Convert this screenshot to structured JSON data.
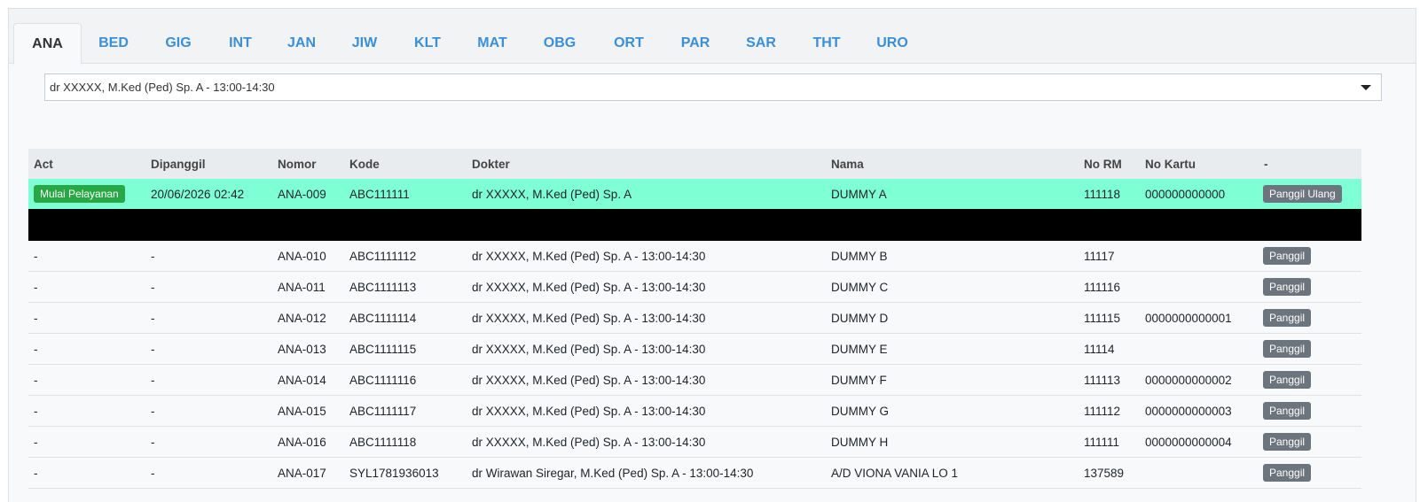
{
  "tabs": [
    {
      "label": "ANA",
      "active": true
    },
    {
      "label": "BED"
    },
    {
      "label": "GIG"
    },
    {
      "label": "INT"
    },
    {
      "label": "JAN"
    },
    {
      "label": "JIW"
    },
    {
      "label": "KLT"
    },
    {
      "label": "MAT"
    },
    {
      "label": "OBG"
    },
    {
      "label": "ORT"
    },
    {
      "label": "PAR"
    },
    {
      "label": "SAR"
    },
    {
      "label": "THT"
    },
    {
      "label": "URO"
    }
  ],
  "doctor_select": {
    "value": "dr XXXXX, M.Ked (Ped) Sp. A - 13:00-14:30"
  },
  "table": {
    "headers": [
      "Act",
      "Dipanggil",
      "Nomor",
      "Kode",
      "Dokter",
      "Nama",
      "No RM",
      "No Kartu",
      "-"
    ],
    "active_row": {
      "act_button": "Mulai Pelayanan",
      "dipanggil": "20/06/2026 02:42",
      "nomor": "ANA-009",
      "kode": "ABC111111",
      "dokter": "dr XXXXX, M.Ked (Ped) Sp. A",
      "nama": "DUMMY A",
      "no_rm": "111118",
      "no_kartu": "000000000000",
      "call_button": "Panggil Ulang"
    },
    "rows": [
      {
        "act": "-",
        "dipanggil": "-",
        "nomor": "ANA-010",
        "kode": "ABC1111112",
        "dokter": "dr XXXXX, M.Ked (Ped) Sp. A - 13:00-14:30",
        "nama": "DUMMY B",
        "no_rm": "11117",
        "no_kartu": "",
        "button": "Panggil"
      },
      {
        "act": "-",
        "dipanggil": "-",
        "nomor": "ANA-011",
        "kode": "ABC1111113",
        "dokter": "dr XXXXX, M.Ked (Ped) Sp. A - 13:00-14:30",
        "nama": "DUMMY C",
        "no_rm": "111116",
        "no_kartu": "",
        "button": "Panggil"
      },
      {
        "act": "-",
        "dipanggil": "-",
        "nomor": "ANA-012",
        "kode": "ABC1111114",
        "dokter": "dr XXXXX, M.Ked (Ped) Sp. A - 13:00-14:30",
        "nama": "DUMMY D",
        "no_rm": "111115",
        "no_kartu": "0000000000001",
        "button": "Panggil"
      },
      {
        "act": "-",
        "dipanggil": "-",
        "nomor": "ANA-013",
        "kode": "ABC1111115",
        "dokter": "dr XXXXX, M.Ked (Ped) Sp. A - 13:00-14:30",
        "nama": "DUMMY E",
        "no_rm": "11114",
        "no_kartu": "",
        "button": "Panggil"
      },
      {
        "act": "-",
        "dipanggil": "-",
        "nomor": "ANA-014",
        "kode": "ABC1111116",
        "dokter": "dr XXXXX, M.Ked (Ped) Sp. A - 13:00-14:30",
        "nama": "DUMMY F",
        "no_rm": "111113",
        "no_kartu": "0000000000002",
        "button": "Panggil"
      },
      {
        "act": "-",
        "dipanggil": "-",
        "nomor": "ANA-015",
        "kode": "ABC1111117",
        "dokter": "dr XXXXX, M.Ked (Ped) Sp. A - 13:00-14:30",
        "nama": "DUMMY G",
        "no_rm": "111112",
        "no_kartu": "0000000000003",
        "button": "Panggil"
      },
      {
        "act": "-",
        "dipanggil": "-",
        "nomor": "ANA-016",
        "kode": "ABC1111118",
        "dokter": "dr XXXXX, M.Ked (Ped) Sp. A - 13:00-14:30",
        "nama": "DUMMY H",
        "no_rm": "111111",
        "no_kartu": "0000000000004",
        "button": "Panggil"
      },
      {
        "act": "-",
        "dipanggil": "-",
        "nomor": "ANA-017",
        "kode": "SYL1781936013",
        "dokter": "dr Wirawan Siregar, M.Ked (Ped) Sp. A - 13:00-14:30",
        "nama": "A/D VIONA VANIA LO 1",
        "no_rm": "137589",
        "no_kartu": "",
        "button": "Panggil"
      }
    ]
  }
}
